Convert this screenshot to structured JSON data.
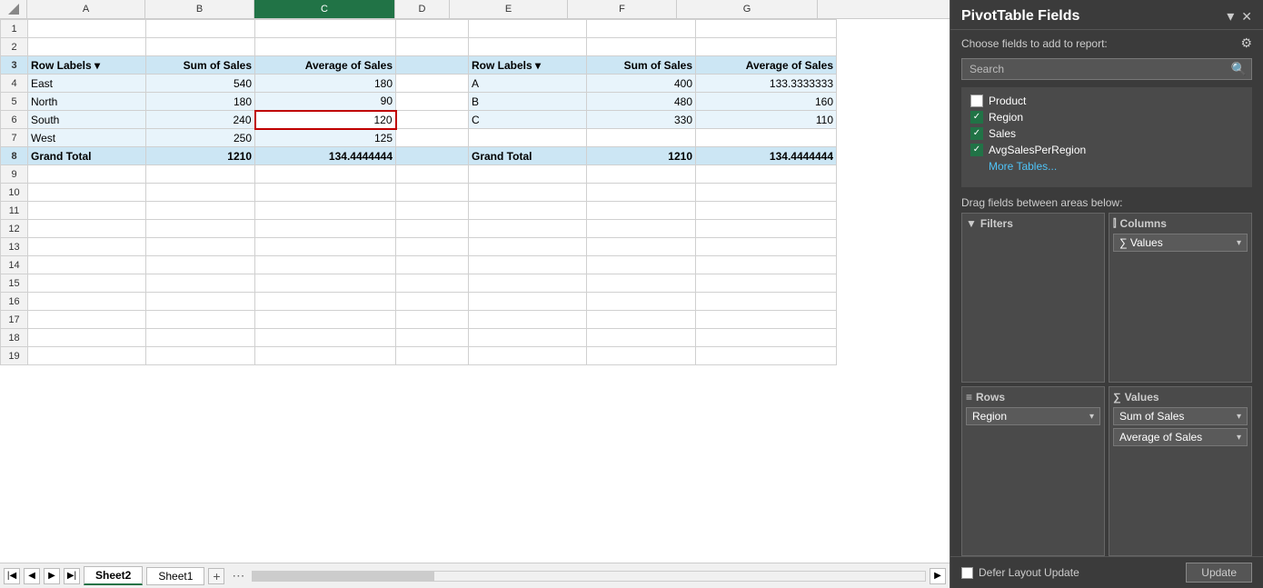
{
  "pivot_panel": {
    "title": "PivotTable Fields",
    "subtitle": "Choose fields to add to report:",
    "search_placeholder": "Search",
    "chevron_down": "▾",
    "close": "✕",
    "settings_icon": "⚙",
    "more_tables": "More Tables...",
    "drag_label": "Drag fields between areas below:",
    "fields": [
      {
        "id": "product",
        "label": "Product",
        "checked": false
      },
      {
        "id": "region",
        "label": "Region",
        "checked": true
      },
      {
        "id": "sales",
        "label": "Sales",
        "checked": true
      },
      {
        "id": "avgsalesperregion",
        "label": "AvgSalesPerRegion",
        "checked": true
      }
    ],
    "areas": {
      "filters": {
        "label": "Filters",
        "icon": "▼",
        "items": []
      },
      "columns": {
        "label": "Columns",
        "icon": "|||",
        "items": [
          {
            "label": "∑ Values",
            "arrow": "▾"
          }
        ]
      },
      "rows": {
        "label": "Rows",
        "icon": "≡",
        "items": [
          {
            "label": "Region",
            "arrow": "▾"
          }
        ]
      },
      "values": {
        "label": "Values",
        "icon": "∑",
        "items": [
          {
            "label": "Sum of Sales",
            "arrow": "▾"
          },
          {
            "label": "Average of Sales",
            "arrow": "▾"
          }
        ]
      }
    },
    "defer_label": "Defer Layout Update",
    "update_btn": "Update"
  },
  "spreadsheet": {
    "col_headers": [
      "A",
      "B",
      "C",
      "D",
      "E",
      "F",
      "G"
    ],
    "selected_col": "C",
    "rows": [
      {
        "num": 1,
        "cells": [
          "",
          "",
          "",
          "",
          "",
          "",
          ""
        ]
      },
      {
        "num": 2,
        "cells": [
          "",
          "",
          "",
          "",
          "",
          "",
          ""
        ]
      },
      {
        "num": 3,
        "cells": [
          "Row Labels",
          "Sum of Sales",
          "Average of Sales",
          "",
          "Row Labels",
          "Sum of Sales",
          "Average of Sales"
        ],
        "type": "header"
      },
      {
        "num": 4,
        "cells": [
          "East",
          "540",
          "180",
          "",
          "A",
          "400",
          "133.3333333"
        ],
        "type": "data"
      },
      {
        "num": 5,
        "cells": [
          "North",
          "180",
          "90",
          "",
          "B",
          "480",
          "160"
        ],
        "type": "data"
      },
      {
        "num": 6,
        "cells": [
          "South",
          "240",
          "120",
          "",
          "C",
          "330",
          "110"
        ],
        "type": "data",
        "selected_c": true
      },
      {
        "num": 7,
        "cells": [
          "West",
          "250",
          "125",
          "",
          "",
          "",
          ""
        ],
        "type": "data"
      },
      {
        "num": 8,
        "cells": [
          "Grand Total",
          "1210",
          "134.4444444",
          "",
          "Grand Total",
          "1210",
          "134.4444444"
        ],
        "type": "total"
      },
      {
        "num": 9,
        "cells": [
          "",
          "",
          "",
          "",
          "",
          "",
          ""
        ]
      },
      {
        "num": 10,
        "cells": [
          "",
          "",
          "",
          "",
          "",
          "",
          ""
        ]
      },
      {
        "num": 11,
        "cells": [
          "",
          "",
          "",
          "",
          "",
          "",
          ""
        ]
      },
      {
        "num": 12,
        "cells": [
          "",
          "",
          "",
          "",
          "",
          "",
          ""
        ]
      },
      {
        "num": 13,
        "cells": [
          "",
          "",
          "",
          "",
          "",
          "",
          ""
        ]
      },
      {
        "num": 14,
        "cells": [
          "",
          "",
          "",
          "",
          "",
          "",
          ""
        ]
      },
      {
        "num": 15,
        "cells": [
          "",
          "",
          "",
          "",
          "",
          "",
          ""
        ]
      },
      {
        "num": 16,
        "cells": [
          "",
          "",
          "",
          "",
          "",
          "",
          ""
        ]
      },
      {
        "num": 17,
        "cells": [
          "",
          "",
          "",
          "",
          "",
          "",
          ""
        ]
      },
      {
        "num": 18,
        "cells": [
          "",
          "",
          "",
          "",
          "",
          "",
          ""
        ]
      },
      {
        "num": 19,
        "cells": [
          "",
          "",
          "",
          "",
          "",
          "",
          ""
        ]
      }
    ],
    "sheets": [
      "Sheet2",
      "Sheet1"
    ],
    "active_sheet": "Sheet2"
  }
}
